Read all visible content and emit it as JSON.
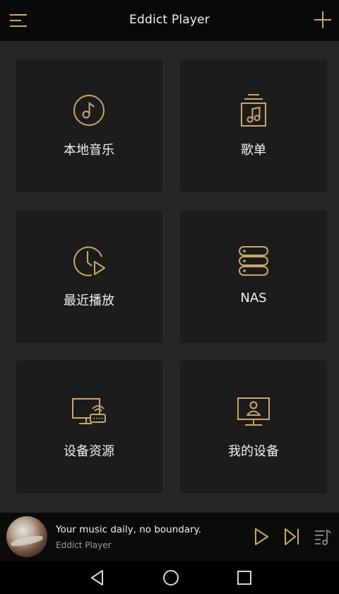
{
  "app": {
    "title": "Eddict Player"
  },
  "icons": {
    "menu": "menu-icon",
    "add": "plus-icon",
    "accent": "#c9a86a"
  },
  "tiles": [
    {
      "label": "本地音乐",
      "icon": "music-note-circle-icon"
    },
    {
      "label": "歌单",
      "icon": "playlist-icon"
    },
    {
      "label": "最近播放",
      "icon": "clock-play-icon"
    },
    {
      "label": "NAS",
      "icon": "server-stack-icon"
    },
    {
      "label": "设备资源",
      "icon": "monitor-device-icon"
    },
    {
      "label": "我的设备",
      "icon": "monitor-user-icon"
    }
  ],
  "player": {
    "song": "Your music daily, no boundary.",
    "artist": "Eddict Player"
  },
  "colors": {
    "background": "#252525",
    "tile": "#1c1c1c",
    "topbar": "#090909",
    "accent": "#c9a86a"
  }
}
